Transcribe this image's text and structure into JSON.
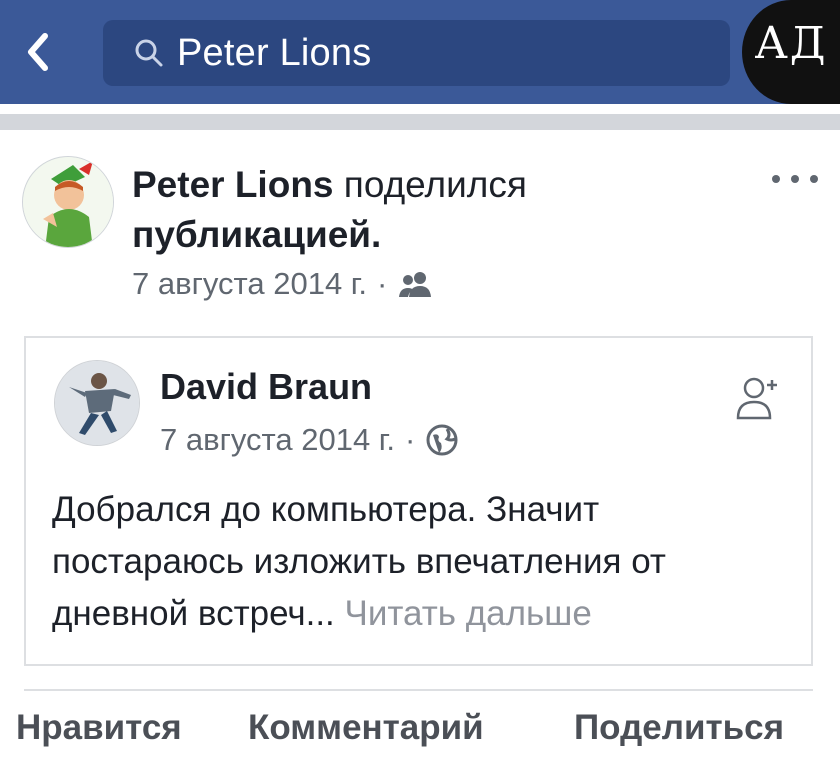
{
  "nav": {
    "back_icon": "chevron-left-icon",
    "search_icon": "search-icon",
    "search_query": "Peter Lions",
    "logo_text": "АД",
    "bar_color": "#3b5998"
  },
  "post": {
    "author": "Peter Lions",
    "action_text": "поделился",
    "object_text": "публикацией.",
    "date": "7 августа 2014 г.",
    "separator": "·",
    "audience_icon": "friends-icon",
    "more_icon": "more-horizontal-icon"
  },
  "shared": {
    "author": "David Braun",
    "date": "7 августа 2014 г.",
    "separator": "·",
    "audience_icon": "globe-icon",
    "add_friend_icon": "add-friend-icon",
    "text": "Добрался до компьютера. Значит постараюсь изложить впечатления от дневной встреч...",
    "read_more": "Читать дальше"
  },
  "actions": {
    "like": "Нравится",
    "comment": "Комментарий",
    "share": "Поделиться"
  }
}
